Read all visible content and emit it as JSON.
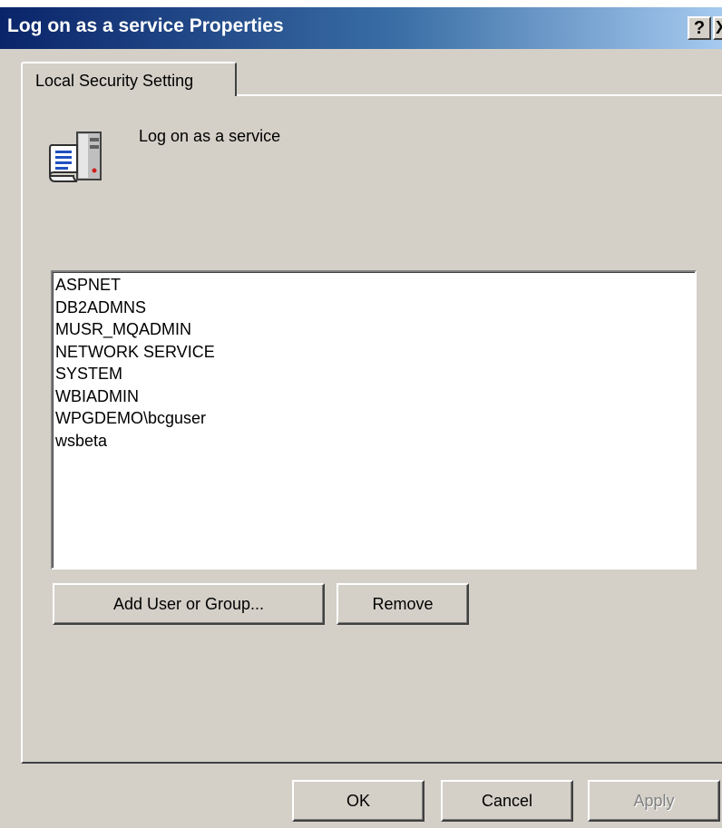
{
  "window": {
    "title": "Log on as a service Properties",
    "help_button": "?",
    "close_button": "X"
  },
  "tab": {
    "label": "Local Security Setting"
  },
  "policy": {
    "name": "Log on as a service",
    "icon": "policy-server-scroll-icon"
  },
  "accounts": [
    "ASPNET",
    "DB2ADMNS",
    "MUSR_MQADMIN",
    "NETWORK SERVICE",
    "SYSTEM",
    "WBIADMIN",
    "WPGDEMO\\bcguser",
    "wsbeta"
  ],
  "buttons": {
    "add": "Add User or Group...",
    "remove": "Remove",
    "ok": "OK",
    "cancel": "Cancel",
    "apply": "Apply"
  },
  "colors": {
    "titlebar_start": "#0a246a",
    "titlebar_end": "#a6caf0",
    "dialog_face": "#d4d0c8",
    "disabled_text": "#808080"
  }
}
